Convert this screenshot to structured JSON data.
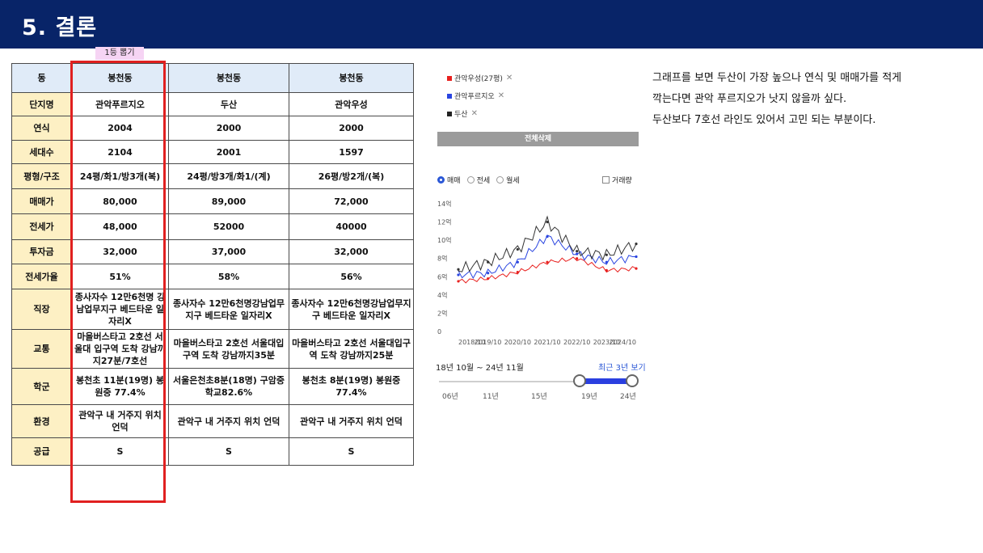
{
  "header": {
    "title": "5. 결론"
  },
  "badge": "1등 뽑기",
  "table": {
    "rows": [
      {
        "label": "동",
        "cells": [
          "봉천동",
          "봉천동",
          "봉천동"
        ]
      },
      {
        "label": "단지명",
        "cells": [
          "관악푸르지오",
          "두산",
          "관악우성"
        ]
      },
      {
        "label": "연식",
        "cells": [
          "2004",
          "2000",
          "2000"
        ]
      },
      {
        "label": "세대수",
        "cells": [
          "2104",
          "2001",
          "1597"
        ]
      },
      {
        "label": "평형/구조",
        "cells": [
          "24평/화1/방3개(복)",
          "24평/방3개/화1/(계)",
          "26평/방2개/(복)"
        ]
      },
      {
        "label": "매매가",
        "cells": [
          "80,000",
          "89,000",
          "72,000"
        ]
      },
      {
        "label": "전세가",
        "cells": [
          "48,000",
          "52000",
          "40000"
        ]
      },
      {
        "label": "투자금",
        "cells": [
          "32,000",
          "37,000",
          "32,000"
        ]
      },
      {
        "label": "전세가율",
        "cells": [
          "51%",
          "58%",
          "56%"
        ]
      },
      {
        "label": "직장",
        "cells": [
          "종사자수 12만6천명 강남업무지구 베드타운 일자리X",
          "종사자수 12만6천명강남업무지구 베드타운 일자리X",
          "종사자수 12만6천명강남업무지구 베드타운 일자리X"
        ]
      },
      {
        "label": "교통",
        "cells": [
          "마을버스타고 2호선 서울대 입구역 도착 강남까지27분/7호선",
          "마을버스타고 2호선 서울대입구역 도착 강남까지35분",
          "마을버스타고 2호선 서울대입구역 도착 강남까지25분"
        ]
      },
      {
        "label": "학군",
        "cells": [
          "봉천초 11분(19명) 봉원중 77.4%",
          "서울은천초8분(18명) 구암중학교82.6%",
          "봉천초 8분(19명) 봉원중 77.4%"
        ]
      },
      {
        "label": "환경",
        "cells": [
          "관악구 내 거주지 위치 언덕",
          "관악구 내 거주지 위치 언덕",
          "관악구 내 거주지 위치 언덕"
        ]
      },
      {
        "label": "공급",
        "cells": [
          "S",
          "S",
          "S"
        ]
      }
    ]
  },
  "chart_panel": {
    "legend": [
      {
        "label": "관악우성(27평)",
        "color": "#e8201e"
      },
      {
        "label": "관악푸르지오",
        "color": "#2a45e0"
      },
      {
        "label": "두산",
        "color": "#222222"
      }
    ],
    "delete_all": "전체삭제",
    "radios": [
      {
        "label": "매매",
        "selected": true
      },
      {
        "label": "전세",
        "selected": false
      },
      {
        "label": "월세",
        "selected": false
      }
    ],
    "volume_label": "거래량",
    "period_label": "18년 10월 ~ 24년 11월",
    "recent_label": "최근 3년 보기",
    "slider_ticks": [
      "06년",
      "11년",
      "15년",
      "19년",
      "24년"
    ]
  },
  "chart_data": {
    "type": "line",
    "x": [
      "2018/10",
      "2019/10",
      "2020/10",
      "2021/10",
      "2022/10",
      "2023/10",
      "2024/10"
    ],
    "y_ticks": [
      "14억",
      "12억",
      "10억",
      "8억",
      "6억",
      "4억",
      "2억",
      "0"
    ],
    "ylim": [
      0,
      14
    ],
    "series": [
      {
        "name": "관악우성(27평)",
        "color": "#e8201e",
        "values": [
          5.5,
          5.8,
          6.5,
          7.6,
          8.0,
          6.7,
          6.9
        ]
      },
      {
        "name": "관악푸르지오",
        "color": "#2a45e0",
        "values": [
          6.2,
          6.4,
          7.6,
          10.4,
          8.5,
          7.6,
          8.2
        ]
      },
      {
        "name": "두산",
        "color": "#333333",
        "values": [
          6.8,
          7.6,
          9.0,
          12.0,
          8.8,
          8.4,
          9.6
        ]
      }
    ]
  },
  "comment": {
    "lines": [
      "그래프를 보면 두산이 가장 높으나 연식 및 매매가를 적게",
      "깍는다면 관악 푸르지오가 낫지 않을까 싶다.",
      "두산보다 7호선 라인도 있어서 고민 되는 부분이다."
    ]
  }
}
